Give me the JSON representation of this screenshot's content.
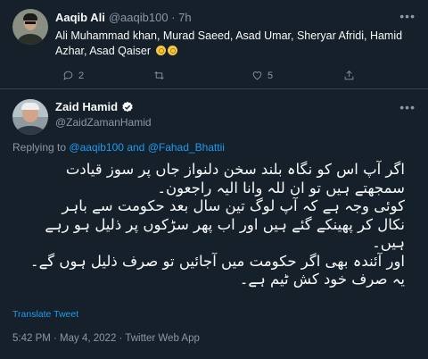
{
  "parent_tweet": {
    "author_name": "Aaqib Ali",
    "handle": "@aaqib100",
    "time": "7h",
    "text": "Ali Muhammad khan, Murad Saeed, Asad Umar, Sheryar Afridi, Hamid Azhar, Asad Qaiser",
    "emoji_icons": [
      "ok-hand-icon",
      "ok-hand-icon"
    ],
    "reply_count": "2",
    "retweet_count": "",
    "like_count": "5"
  },
  "main_tweet": {
    "author_name": "Zaid Hamid",
    "handle": "@ZaidZamanHamid",
    "replying_prefix": "Replying to",
    "replying_user1": "@aaqib100",
    "replying_and": "and",
    "replying_user2": "@Fahad_Bhattii",
    "text_lines": [
      "اگر آپ اس کو نگاہ بلند سخن دلنواز جاں پر سوز قیادت",
      "سمجھتے ہیں تو ان للہ وانا الیہ راجعون۔",
      "کوئی وجہ ہے کہ آپ لوگ تین سال بعد حکومت سے باہر",
      "نکال کر پھینکے گئے ہیں اور اب پھر سڑکوں پر ذلیل ہو رہے",
      "ہیں۔",
      "اور آئندہ بھی اگر حکومت میں آجائیں تو صرف ذلیل ہوں گے۔",
      "یہ صرف خود کش ٹیم ہے۔"
    ],
    "translate_label": "Translate Tweet",
    "timestamp": "5:42 PM · May 4, 2022 · Twitter Web App"
  },
  "colors": {
    "background": "#15202b",
    "text": "#f7f9f9",
    "muted": "#8b98a5",
    "accent": "#1d9bf0",
    "divider": "#38444d"
  }
}
